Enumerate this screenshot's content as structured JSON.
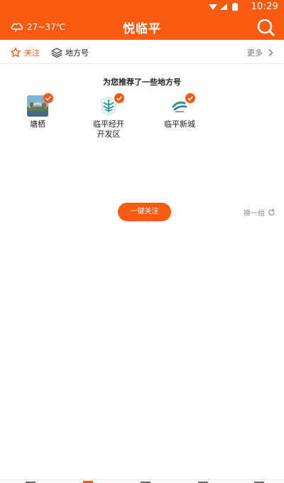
{
  "status_bar": {
    "time": "10:29"
  },
  "app_bar": {
    "weather": "27~37℃",
    "title": "悦临平"
  },
  "subtabs": {
    "follow": "关注",
    "place": "地方号",
    "more": "更多"
  },
  "recommend": {
    "title": "为您推荐了一些地方号",
    "items": [
      {
        "name": "塘栖"
      },
      {
        "name": "临平经开\n开发区"
      },
      {
        "name": "临平新城"
      }
    ]
  },
  "actions": {
    "follow_all": "一键关注",
    "refresh": "换一组"
  },
  "colors": {
    "brand": "#fb5a13",
    "check": "#fb5a13"
  }
}
